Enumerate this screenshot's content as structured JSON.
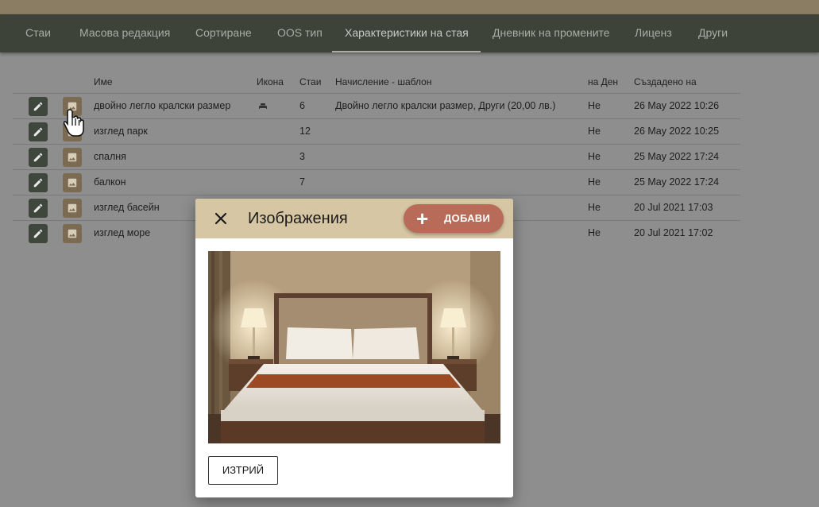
{
  "nav": {
    "tabs": [
      {
        "label": "Стаи"
      },
      {
        "label": "Масова редакция"
      },
      {
        "label": "Сортиране"
      },
      {
        "label": "OOS тип"
      },
      {
        "label": "Характеристики на стая"
      },
      {
        "label": "Дневник на промените"
      },
      {
        "label": "Лиценз"
      },
      {
        "label": "Други"
      }
    ]
  },
  "table": {
    "headers": {
      "name": "Име",
      "icon": "Икона",
      "rooms": "Стаи",
      "charge": "Начисление - шаблон",
      "per_day": "на Ден",
      "created": "Създадено на"
    },
    "rows": [
      {
        "name": "двойно легло кралски размер",
        "icon": "bed-icon",
        "rooms": "6",
        "charge": "Двойно легло кралски размер, Други (20,00 лв.)",
        "per_day": "Не",
        "created": "26 May 2022 10:26"
      },
      {
        "name": "изглед парк",
        "rooms": "12",
        "charge": "",
        "per_day": "Не",
        "created": "26 May 2022 10:25"
      },
      {
        "name": "спалня",
        "rooms": "3",
        "charge": "",
        "per_day": "Не",
        "created": "25 May 2022 17:24"
      },
      {
        "name": "балкон",
        "rooms": "7",
        "charge": "",
        "per_day": "Не",
        "created": "25 May 2022 17:24"
      },
      {
        "name": "изглед басейн",
        "rooms": "",
        "charge": "",
        "per_day": "Не",
        "created": "20 Jul 2021 17:03"
      },
      {
        "name": "изглед море",
        "rooms": "",
        "charge": "",
        "per_day": "Не",
        "created": "20 Jul 2021 17:02"
      }
    ]
  },
  "dialog": {
    "title": "Изображения",
    "add_label": "ДОБАВИ",
    "delete_label": "ИЗТРИЙ"
  },
  "colors": {
    "navbar": "#3d4338",
    "edit_button": "#3f463b",
    "image_button": "#7a6b52",
    "dialog_header": "#d7c6a3",
    "add_button": "#b86b58"
  }
}
